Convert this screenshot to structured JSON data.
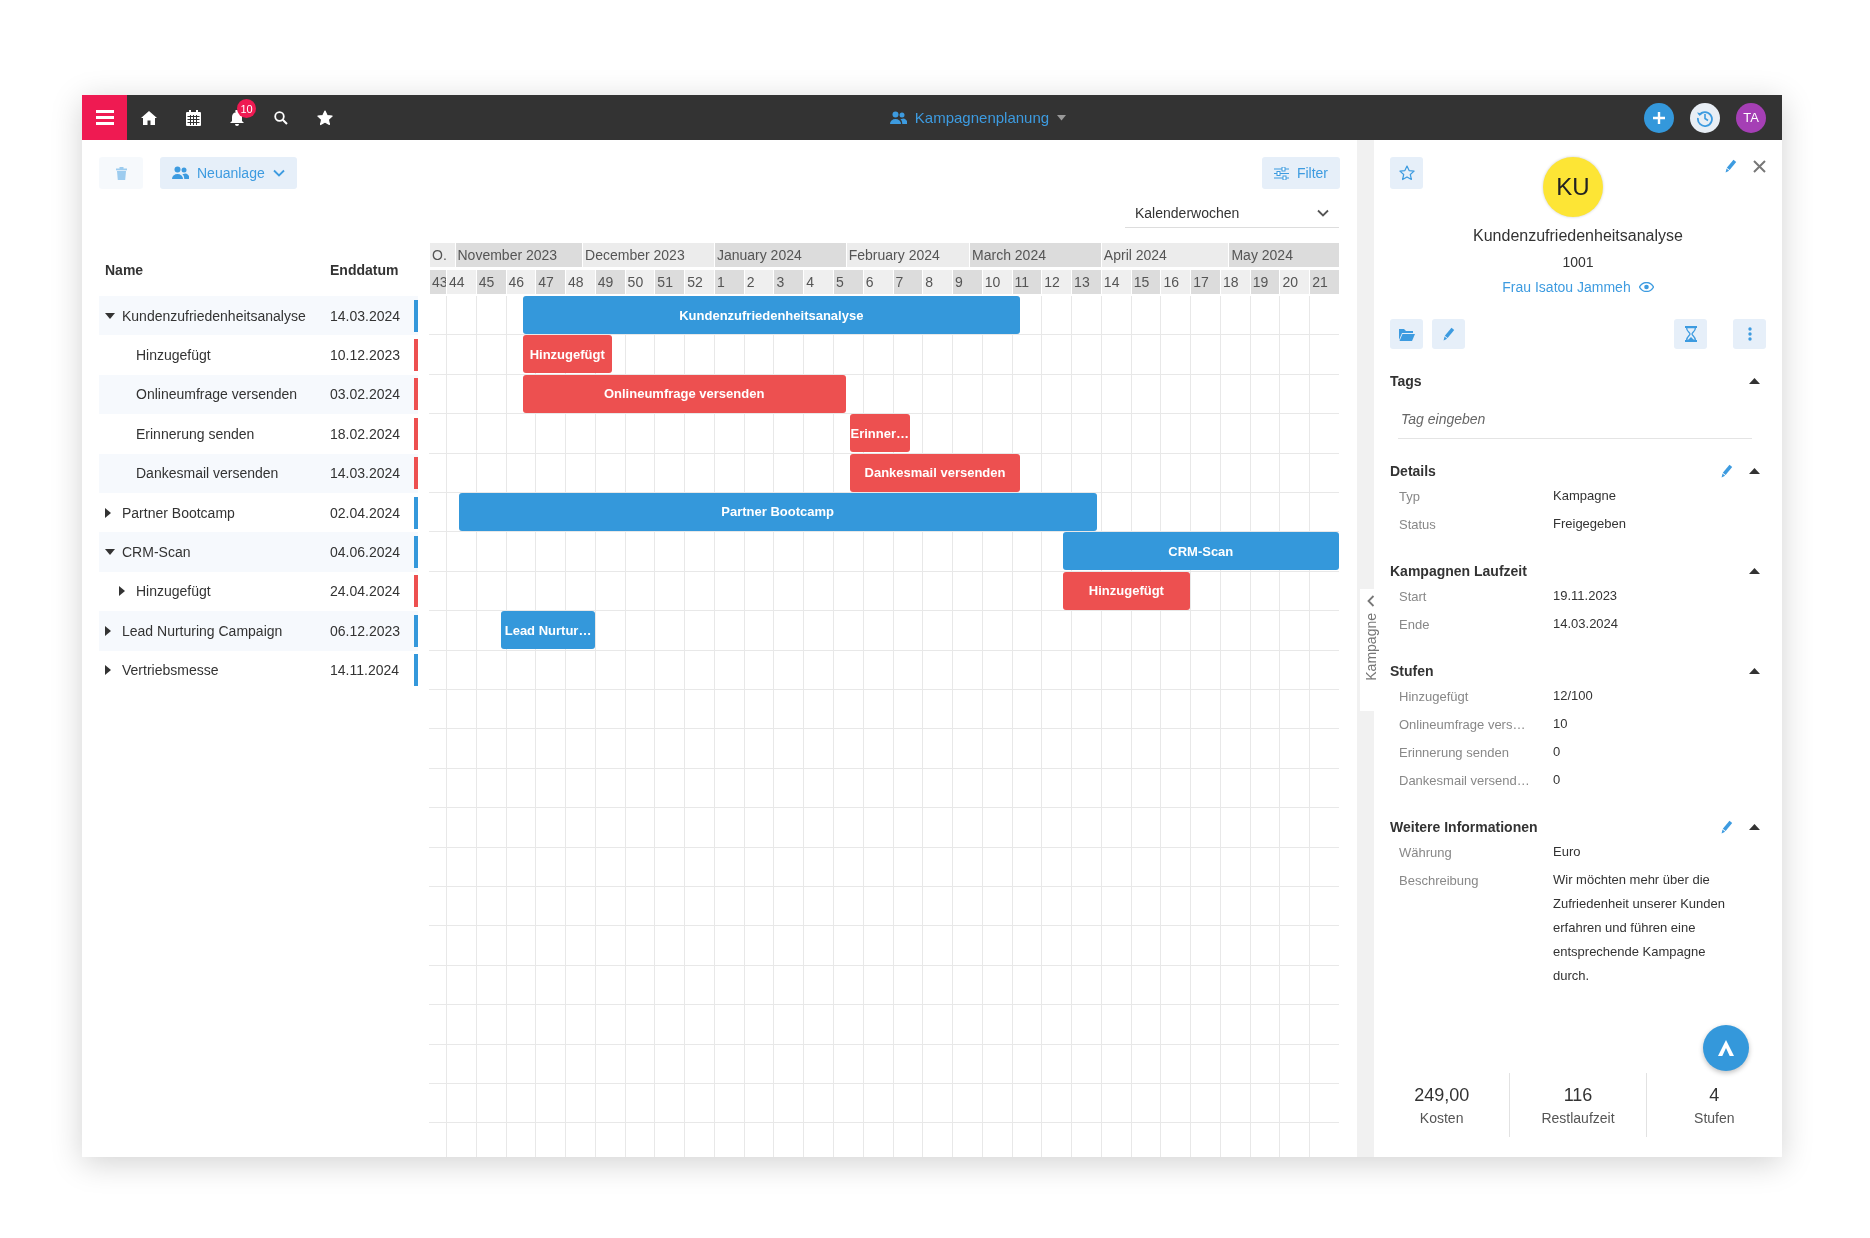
{
  "topbar": {
    "notification_badge": "10",
    "title": "Kampagnenplanung",
    "avatar": "TA"
  },
  "toolbar": {
    "delete_button": {
      "disabled": true
    },
    "new_button": "Neuanlage",
    "filter_button": "Filter",
    "view_select": "Kalenderwochen"
  },
  "tree": {
    "columns": [
      "Name",
      "Enddatum"
    ],
    "rows": [
      {
        "name": "Kundenzufriedenheitsanalyse",
        "end_date": "14.03.2024",
        "color": "#3498db",
        "expanded": true,
        "children": [
          {
            "name": "Hinzugefügt",
            "end_date": "10.12.2023",
            "color": "#ed5050"
          },
          {
            "name": "Onlineumfrage versenden",
            "end_date": "03.02.2024",
            "color": "#ed5050"
          },
          {
            "name": "Erinnerung senden",
            "end_date": "18.02.2024",
            "color": "#ed5050"
          },
          {
            "name": "Dankesmail versenden",
            "end_date": "14.03.2024",
            "color": "#ed5050"
          }
        ]
      },
      {
        "name": "Partner Bootcamp",
        "end_date": "02.04.2024",
        "color": "#3498db",
        "expanded": false
      },
      {
        "name": "CRM-Scan",
        "end_date": "04.06.2024",
        "color": "#3498db",
        "expanded": true,
        "children": [
          {
            "name": "Hinzugefügt",
            "end_date": "24.04.2024",
            "color": "#ed5050",
            "expanded": false
          }
        ]
      },
      {
        "name": "Lead Nurturing Campaign",
        "end_date": "06.12.2023",
        "color": "#3498db",
        "expanded": false
      },
      {
        "name": "Vertriebsmesse",
        "end_date": "14.11.2024",
        "color": "#3498db",
        "expanded": false
      }
    ]
  },
  "gantt_bars": [
    {
      "label": "Kundenzufriedenheitsanalyse"
    },
    {
      "label": "Hinzugefügt"
    },
    {
      "label": "Onlineumfrage versenden"
    },
    {
      "label": "Erinner…"
    },
    {
      "label": "Dankesmail versenden"
    },
    {
      "label": "Partner Bootcamp"
    },
    {
      "label": "CRM-Scan"
    },
    {
      "label": "Hinzugefügt"
    },
    {
      "label": "Lead Nurtur…"
    }
  ],
  "timeline": {
    "months": [
      "O.",
      "November 2023",
      "December 2023",
      "January 2024",
      "February 2024",
      "March 2024",
      "April 2024",
      "May 2024"
    ],
    "weeks": [
      "43",
      "44",
      "45",
      "46",
      "47",
      "48",
      "49",
      "50",
      "51",
      "52",
      "1",
      "2",
      "3",
      "4",
      "5",
      "6",
      "7",
      "8",
      "9",
      "10",
      "11",
      "12",
      "13",
      "14",
      "15",
      "16",
      "17",
      "18",
      "19",
      "20",
      "21"
    ]
  },
  "side_tab": "Kampagne",
  "detail_panel": {
    "avatar": "KU",
    "title": "Kundenzufriedenheitsanalyse",
    "number": "1001",
    "contact": "Frau Isatou Jammeh",
    "sections": [
      {
        "title": "Tags",
        "kind": "tags",
        "expanded": true,
        "placeholder": "Tag eingeben"
      },
      {
        "title": "Details",
        "kind": "fields",
        "expanded": true,
        "editable": true,
        "fields": [
          {
            "label": "Typ",
            "value": "Kampagne"
          },
          {
            "label": "Status",
            "value": "Freigegeben"
          }
        ]
      },
      {
        "title": "Kampagnen Laufzeit",
        "kind": "fields",
        "expanded": true,
        "editable": false,
        "fields": [
          {
            "label": "Start",
            "value": "19.11.2023"
          },
          {
            "label": "Ende",
            "value": "14.03.2024"
          }
        ]
      },
      {
        "title": "Stufen",
        "kind": "fields",
        "expanded": true,
        "editable": false,
        "fields": [
          {
            "label": "Hinzugefügt",
            "value": "12/100"
          },
          {
            "label": "Onlineumfrage vers…",
            "value": "10"
          },
          {
            "label": "Erinnerung senden",
            "value": "0"
          },
          {
            "label": "Dankesmail versend…",
            "value": "0"
          }
        ]
      },
      {
        "title": "Weitere Informationen",
        "kind": "fields",
        "expanded": true,
        "editable": true,
        "fields": [
          {
            "label": "Währung",
            "value": "Euro"
          },
          {
            "label": "Beschreibung",
            "value": "Wir möchten mehr über die Zufriedenheit unserer Kunden erfahren und führen eine entsprechende Kampagne durch."
          }
        ]
      }
    ],
    "stats": [
      {
        "value": "249,00",
        "label": "Kosten"
      },
      {
        "value": "116",
        "label": "Restlaufzeit"
      },
      {
        "value": "4",
        "label": "Stufen"
      }
    ]
  }
}
